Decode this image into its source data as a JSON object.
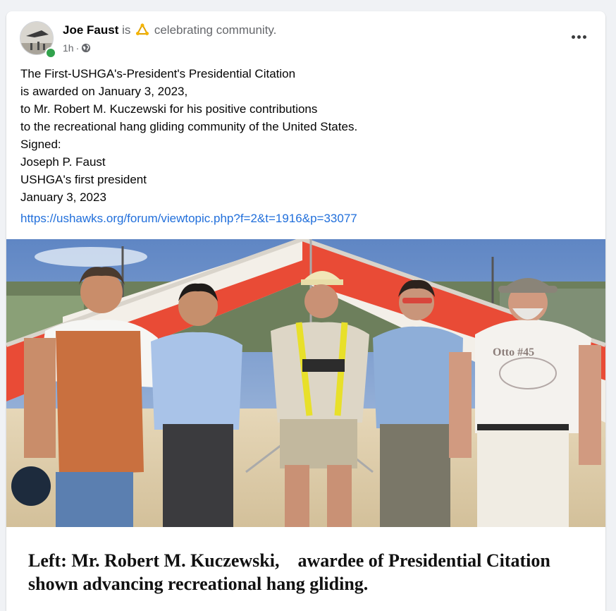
{
  "post": {
    "author": "Joe Faust",
    "activity_prefix": "is",
    "activity_icon": "celebrate-icon",
    "activity_text": "celebrating community.",
    "timestamp": "1h",
    "separator": "·",
    "privacy_icon": "globe-icon",
    "more_icon": "more-options-icon",
    "text_lines": [
      "The First-USHGA's-President's Presidential Citation",
      "is awarded on January 3, 2023,",
      "to Mr. Robert M. Kuczewski for his positive contributions",
      "to the recreational hang gliding community of the United States.",
      "Signed:",
      "Joseph P. Faust",
      "USHGA's first president",
      "January 3, 2023"
    ],
    "link": "https://ushawks.org/forum/viewtopic.php?f=2&t=1916&p=33077"
  },
  "image": {
    "caption_line1": "Left: Mr. Robert M. Kuczewski,    awardee of Presidential Citation",
    "caption_line2": "shown advancing recreational hang gliding.",
    "shirt_text": "Otto #45"
  },
  "colors": {
    "accent_link": "#216fdb",
    "online": "#31a24c",
    "glider_red": "#e8412c"
  }
}
